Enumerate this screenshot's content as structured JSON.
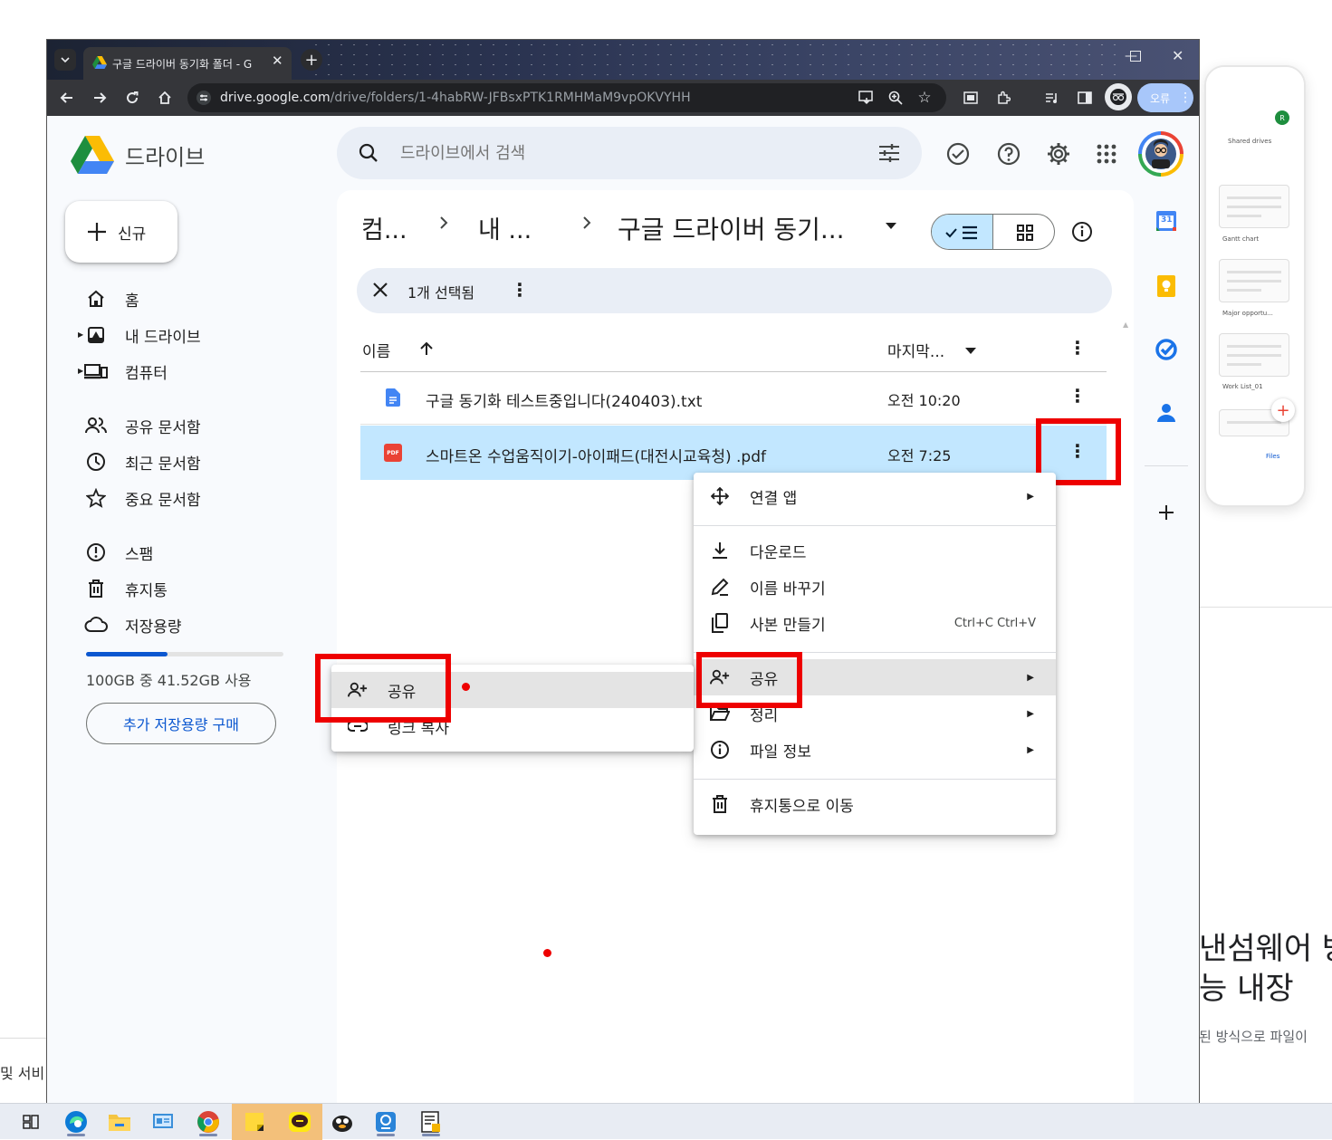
{
  "browser": {
    "tab_title": "구글 드라이버 동기화 폴더 - G",
    "url_host": "drive.google.com",
    "url_path": "/drive/folders/1-4habRW-JFBsxPTK1RMHMaM9vpOKVYHH",
    "profile_label": "오류"
  },
  "drive": {
    "logo_text": "드라이브",
    "search_placeholder": "드라이브에서 검색",
    "new_button": "신규",
    "nav": [
      {
        "label": "홈",
        "icon": "home-icon"
      },
      {
        "label": "내 드라이브",
        "icon": "my-drive-icon"
      },
      {
        "label": "컴퓨터",
        "icon": "computers-icon"
      },
      {
        "label": "공유 문서함",
        "icon": "shared-icon"
      },
      {
        "label": "최근 문서함",
        "icon": "clock-icon"
      },
      {
        "label": "중요 문서함",
        "icon": "star-icon"
      },
      {
        "label": "스팸",
        "icon": "spam-icon"
      },
      {
        "label": "휴지통",
        "icon": "trash-icon"
      },
      {
        "label": "저장용량",
        "icon": "cloud-icon"
      }
    ],
    "storage": {
      "text": "100GB 중 41.52GB 사용",
      "used_fraction": 0.415,
      "buy_button": "추가 저장용량 구매"
    },
    "breadcrumb": [
      "컴...",
      "내 ...",
      "구글 드라이버 동기..."
    ],
    "selection_text": "1개 선택됨",
    "columns": {
      "name": "이름",
      "modified": "마지막..."
    },
    "files": [
      {
        "name": "구글 동기화 테스트중입니다(240403).txt",
        "modified": "오전 10:20",
        "type": "doc",
        "selected": false
      },
      {
        "name": "스마트온 수업움직이기-아이패드(대전시교육청) .pdf",
        "modified": "오전 7:25",
        "type": "pdf",
        "selected": true
      }
    ],
    "pdf_badge": "PDF",
    "calendar_day": "31"
  },
  "context_menu": {
    "open_with": "연결 앱",
    "download": "다운로드",
    "rename": "이름 바꾸기",
    "copy": "사본 만들기",
    "copy_shortcut": "Ctrl+C Ctrl+V",
    "share": "공유",
    "organize": "정리",
    "file_info": "파일 정보",
    "trash": "휴지통으로 이동"
  },
  "share_submenu": {
    "share": "공유",
    "copy_link": "링크 복사"
  },
  "background": {
    "phone_header": "Shared drives",
    "phone_items": [
      "Gantt chart",
      "Major opportu...",
      "Work List_01"
    ],
    "phone_tab": "Files",
    "headline_line1": "낸섬웨어 방",
    "headline_line2": "능 내장",
    "subtext": "된 방식으로 파일이",
    "left_fragment": "및 서비"
  },
  "colors": {
    "accent": "#0b57d0",
    "selected_row": "#c2e7ff",
    "highlight_box": "#ee0000",
    "pdf_red": "#ea4335"
  }
}
